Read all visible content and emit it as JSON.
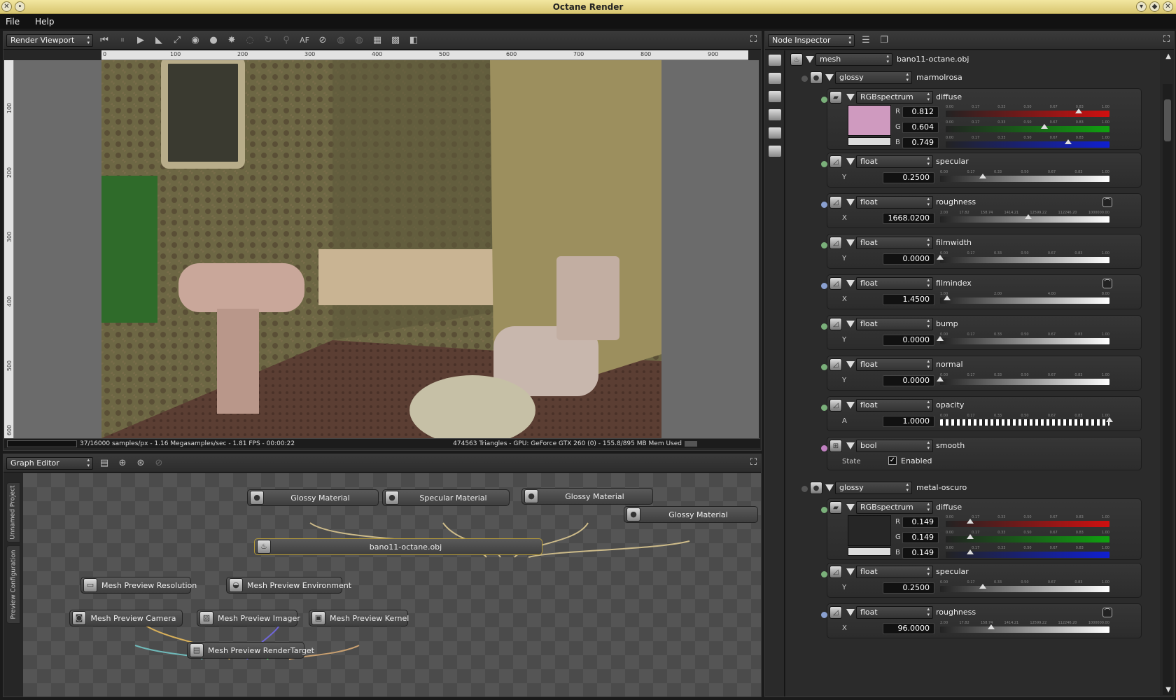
{
  "window": {
    "title": "Octane Render"
  },
  "menu": [
    "File",
    "Help"
  ],
  "viewport": {
    "panel_label": "Render Viewport",
    "af_label": "AF",
    "ruler_h": [
      "0",
      "100",
      "200",
      "300",
      "400",
      "500",
      "600",
      "700",
      "800",
      "900"
    ],
    "ruler_v": [
      "100",
      "200",
      "300",
      "400",
      "500",
      "600"
    ],
    "status_left": "37/16000 samples/px - 1.16 Megasamples/sec - 1.81 FPS - 00:00:22",
    "status_right": "474563 Triangles - GPU: GeForce GTX 260 (0) - 155.8/895 MB Mem Used"
  },
  "graph_editor": {
    "panel_label": "Graph Editor",
    "tabs": [
      "Unnamed Project",
      "Preview Configuration"
    ],
    "nodes": {
      "glossy1": "Glossy Material",
      "specular": "Specular Material",
      "glossy2": "Glossy Material",
      "glossy3": "Glossy Material",
      "mesh": "bano11-octane.obj",
      "resolution": "Mesh Preview Resolution",
      "environment": "Mesh Preview Environment",
      "camera": "Mesh Preview Camera",
      "imager": "Mesh Preview Imager",
      "kernel": "Mesh Preview Kernel",
      "target": "Mesh Preview RenderTarget"
    }
  },
  "node_inspector": {
    "panel_label": "Node Inspector",
    "mesh": {
      "type": "mesh",
      "name": "bano11-octane.obj"
    },
    "material1": {
      "type": "glossy",
      "name": "marmolrosa",
      "diffuse": {
        "type": "RGBspectrum",
        "name": "diffuse",
        "r": "0.812",
        "g": "0.604",
        "b": "0.749",
        "swatch": "#cf9abf"
      },
      "specular": {
        "type": "float",
        "name": "specular",
        "chan": "Y",
        "value": "0.2500"
      },
      "roughness": {
        "type": "float",
        "name": "roughness",
        "chan": "X",
        "value": "1668.0200"
      },
      "filmwidth": {
        "type": "float",
        "name": "filmwidth",
        "chan": "Y",
        "value": "0.0000"
      },
      "filmindex": {
        "type": "float",
        "name": "filmindex",
        "chan": "X",
        "value": "1.4500"
      },
      "bump": {
        "type": "float",
        "name": "bump",
        "chan": "Y",
        "value": "0.0000"
      },
      "normal": {
        "type": "float",
        "name": "normal",
        "chan": "Y",
        "value": "0.0000"
      },
      "opacity": {
        "type": "float",
        "name": "opacity",
        "chan": "A",
        "value": "1.0000"
      },
      "smooth": {
        "type": "bool",
        "name": "smooth",
        "state_label": "State",
        "check_label": "Enabled"
      }
    },
    "material2": {
      "type": "glossy",
      "name": "metal-oscuro",
      "diffuse": {
        "type": "RGBspectrum",
        "name": "diffuse",
        "r": "0.149",
        "g": "0.149",
        "b": "0.149",
        "swatch": "#262626"
      },
      "specular": {
        "type": "float",
        "name": "specular",
        "chan": "Y",
        "value": "0.2500"
      },
      "roughness": {
        "type": "float",
        "name": "roughness",
        "chan": "X",
        "value": "96.0000"
      }
    },
    "ticks_unit": [
      "0.00",
      "0.17",
      "0.33",
      "0.50",
      "0.67",
      "0.83",
      "1.00"
    ],
    "ticks_rough": [
      "2.00",
      "17.82",
      "158.74",
      "1414.21",
      "12599.22",
      "112246.20",
      "1000000.00"
    ],
    "ticks_index": [
      "1.00",
      "2.00",
      "4.00",
      "8.00"
    ]
  },
  "colors": {
    "accent_title": "#e6d890",
    "red": "#d01010",
    "green": "#10a010",
    "blue": "#1020d0"
  }
}
